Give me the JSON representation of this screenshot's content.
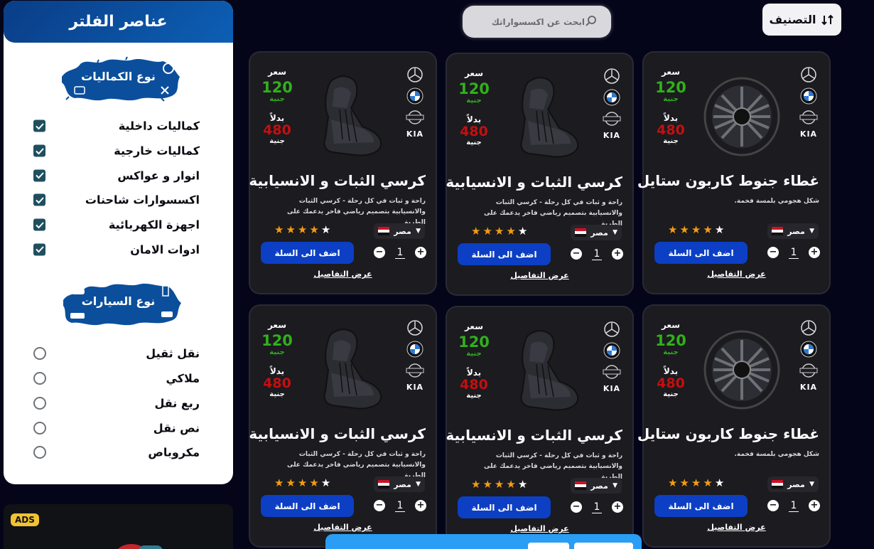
{
  "sidebar": {
    "title": "عناصر الفلتر",
    "accessories_section": {
      "label": "نوع الكماليات",
      "items": [
        {
          "label": "كماليات داخلية",
          "checked": true
        },
        {
          "label": "كماليات خارجية",
          "checked": true
        },
        {
          "label": "انوار و عواكس",
          "checked": true
        },
        {
          "label": "اكسسوارات شاحنات",
          "checked": true
        },
        {
          "label": "اجهزة الكهربائية",
          "checked": true
        },
        {
          "label": "ادوات الامان",
          "checked": true
        }
      ]
    },
    "cars_section": {
      "label": "نوع السيارات",
      "items": [
        {
          "label": "نقل ثقيل",
          "checked": false
        },
        {
          "label": "ملاكي",
          "checked": false
        },
        {
          "label": "ربع نقل",
          "checked": false
        },
        {
          "label": "نص نقل",
          "checked": false
        },
        {
          "label": "مكروباص",
          "checked": false
        }
      ]
    }
  },
  "ads": {
    "badge": "ADS"
  },
  "search": {
    "placeholder": "ابحث عن اكسسواراتك"
  },
  "sort": {
    "label": "التصنيف",
    "icon": "sort-icon"
  },
  "products": [
    {
      "title": "غطاء جنوط كاربون ستايل",
      "desc": "شكل هجومي بلمسة فخمة.",
      "price_label": "سعر",
      "price": "120",
      "currency": "جنية",
      "instead_label": "بدلاً",
      "old_price": "480",
      "old_currency": "جنية",
      "country": "مصر",
      "rating": 4,
      "add_label": "اضف الى السلة",
      "qty": "1",
      "details_label": "عرض التفاصيل",
      "image": "wheel",
      "kia": "KIA"
    },
    {
      "title": "كرسي الثبات و الانسيابية",
      "desc": "راحة و ثبات في كل رحلة - كرسي الثبات والانسيابية بتصميم رياضي فاخر يدعمك على الطريق",
      "price_label": "سعر",
      "price": "120",
      "currency": "جنية",
      "instead_label": "بدلاً",
      "old_price": "480",
      "old_currency": "جنية",
      "country": "مصر",
      "rating": 4,
      "add_label": "اضف الى السلة",
      "qty": "1",
      "details_label": "عرض التفاصيل",
      "image": "seat",
      "kia": "KIA"
    },
    {
      "title": "كرسي الثبات و الانسيابية",
      "desc": "راحة و ثبات في كل رحلة - كرسي الثبات والانسيابية بتصميم رياضي فاخر يدعمك على الطريق",
      "price_label": "سعر",
      "price": "120",
      "currency": "جنية",
      "instead_label": "بدلاً",
      "old_price": "480",
      "old_currency": "جنية",
      "country": "مصر",
      "rating": 4,
      "add_label": "اضف الى السلة",
      "qty": "1",
      "details_label": "عرض التفاصيل",
      "image": "seat",
      "kia": "KIA"
    },
    {
      "title": "غطاء جنوط كاربون ستايل",
      "desc": "شكل هجومي بلمسة فخمة.",
      "price_label": "سعر",
      "price": "120",
      "currency": "جنية",
      "instead_label": "بدلاً",
      "old_price": "480",
      "old_currency": "جنية",
      "country": "مصر",
      "rating": 4,
      "add_label": "اضف الى السلة",
      "qty": "1",
      "details_label": "عرض التفاصيل",
      "image": "wheel",
      "kia": "KIA"
    },
    {
      "title": "كرسي الثبات و الانسيابية",
      "desc": "راحة و ثبات في كل رحلة - كرسي الثبات والانسيابية بتصميم رياضي فاخر يدعمك على الطريق",
      "price_label": "سعر",
      "price": "120",
      "currency": "جنية",
      "instead_label": "بدلاً",
      "old_price": "480",
      "old_currency": "جنية",
      "country": "مصر",
      "rating": 4,
      "add_label": "اضف الى السلة",
      "qty": "1",
      "details_label": "عرض التفاصيل",
      "image": "seat",
      "kia": "KIA"
    },
    {
      "title": "كرسي الثبات و الانسيابية",
      "desc": "راحة و ثبات في كل رحلة - كرسي الثبات والانسيابية بتصميم رياضي فاخر يدعمك على الطريق",
      "price_label": "سعر",
      "price": "120",
      "currency": "جنية",
      "instead_label": "بدلاً",
      "old_price": "480",
      "old_currency": "جنية",
      "country": "مصر",
      "rating": 4,
      "add_label": "اضف الى السلة",
      "qty": "1",
      "details_label": "عرض التفاصيل",
      "image": "seat",
      "kia": "KIA"
    }
  ],
  "colors": {
    "accent": "#0c3fc4",
    "price_new": "#31b01a",
    "price_old": "#c40f0f",
    "star": "#f39c12",
    "header": "#0a3d86"
  }
}
